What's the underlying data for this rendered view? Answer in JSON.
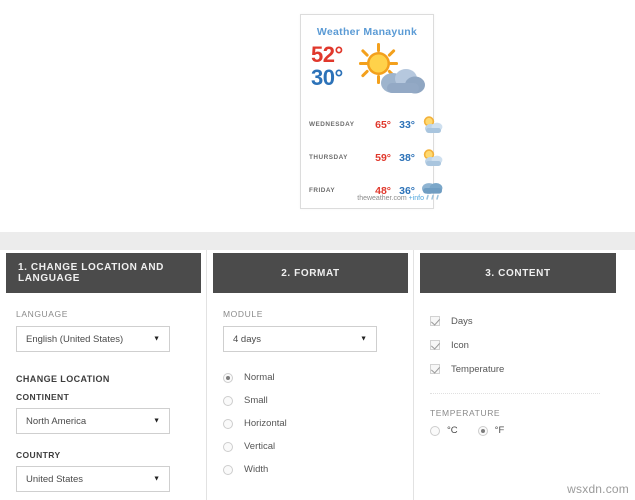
{
  "widget": {
    "title": "Weather Manayunk",
    "current": {
      "high": "52°",
      "low": "30°",
      "icon": "sun-behind-cloud-icon"
    },
    "forecast": [
      {
        "day": "WEDNESDAY",
        "high": "65°",
        "low": "33°",
        "icon": "sun-behind-cloud-icon"
      },
      {
        "day": "THURSDAY",
        "high": "59°",
        "low": "38°",
        "icon": "sun-behind-cloud-icon"
      },
      {
        "day": "FRIDAY",
        "high": "48°",
        "low": "36°",
        "icon": "rain-cloud-icon"
      }
    ],
    "footer": {
      "source": "theweather.com",
      "info_link": "+info"
    },
    "colors": {
      "title": "#5b9bd5",
      "high": "#e0382c",
      "low": "#2c72b8",
      "link": "#4ea6dd"
    }
  },
  "panels": [
    {
      "header": "1. CHANGE LOCATION AND LANGUAGE",
      "language_label": "LANGUAGE",
      "language_value": "English (United States)",
      "change_location_title": "CHANGE LOCATION",
      "continent_label": "CONTINENT",
      "continent_value": "North America",
      "country_label": "COUNTRY",
      "country_value": "United States"
    },
    {
      "header": "2. FORMAT",
      "module_label": "MODULE",
      "module_value": "4 days",
      "options": [
        {
          "label": "Normal",
          "selected": true
        },
        {
          "label": "Small",
          "selected": false
        },
        {
          "label": "Horizontal",
          "selected": false
        },
        {
          "label": "Vertical",
          "selected": false
        },
        {
          "label": "Width",
          "selected": false
        }
      ]
    },
    {
      "header": "3. CONTENT",
      "checkboxes": [
        {
          "label": "Days",
          "checked": true
        },
        {
          "label": "Icon",
          "checked": true
        },
        {
          "label": "Temperature",
          "checked": true
        }
      ],
      "temperature_label": "TEMPERATURE",
      "units": [
        {
          "label": "°C",
          "selected": false
        },
        {
          "label": "°F",
          "selected": true
        }
      ]
    }
  ],
  "watermark": "wsxdn.com"
}
